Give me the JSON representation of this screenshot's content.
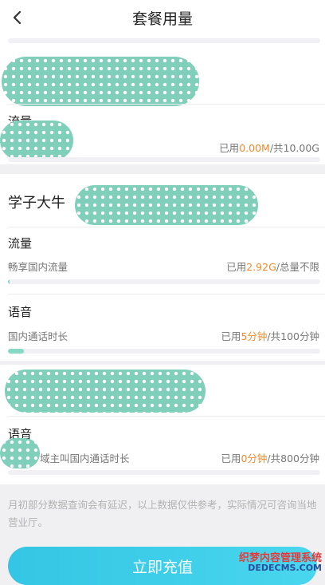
{
  "header": {
    "title": "套餐用量"
  },
  "section1": {
    "category": "流量",
    "usage": {
      "prefix": "已用",
      "used": "0.00M",
      "suffix": "/共10.00G"
    },
    "progress": 0
  },
  "section2": {
    "plan_name": "学子大牛",
    "data": {
      "category": "流量",
      "desc": "畅享国内流量",
      "usage": {
        "prefix": "已用",
        "used": "2.92G",
        "suffix": "/总量不限"
      },
      "progress": 0.005
    },
    "voice": {
      "category": "语音",
      "desc": "国内通话时长",
      "usage": {
        "prefix": "已用",
        "used": "5分钟",
        "suffix": "/共100分钟"
      },
      "progress": 0.05
    }
  },
  "section3": {
    "category": "语音",
    "desc": "域主叫国内通话时长",
    "usage": {
      "prefix": "已用",
      "used": "0分钟",
      "suffix": "/共800分钟"
    },
    "progress": 0
  },
  "notice": "月初部分数据查询会有延迟，以上数据仅供参考，实际情况可咨询当地营业厅。",
  "recharge_label": "立即充值",
  "watermark": {
    "line1": "织梦内容管理系统",
    "line2": "DEDECMS.COM"
  },
  "colors": {
    "accent": "#f08a2d",
    "button": "#3fcde9",
    "progress": "#86d9c3",
    "redaction": "#7fcfbb"
  }
}
